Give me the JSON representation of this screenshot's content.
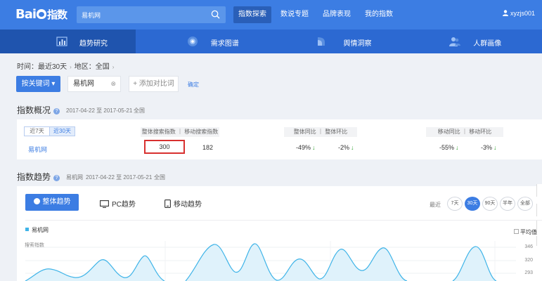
{
  "header": {
    "logo_text": "Bai",
    "logo_suffix": "指数",
    "search": {
      "value": "易机网"
    },
    "nav": [
      {
        "label": "指数探索",
        "active": true
      },
      {
        "label": "数说专题",
        "active": false
      },
      {
        "label": "品牌表现",
        "active": false
      },
      {
        "label": "我的指数",
        "active": false
      }
    ],
    "user": "xyzjs001"
  },
  "subnav": [
    {
      "label": "趋势研究",
      "icon": "bar-chart-icon",
      "active": true
    },
    {
      "label": "需求图谱",
      "icon": "target-icon",
      "active": false
    },
    {
      "label": "舆情洞察",
      "icon": "insight-icon",
      "active": false
    },
    {
      "label": "人群画像",
      "icon": "people-icon",
      "active": false
    }
  ],
  "filters": {
    "time": "时间：最近30天",
    "region": "地区：全国",
    "keyword_button": "按关键词",
    "keyword": "易机网",
    "add_compare": "+ 添加对比词",
    "confirm": "确定"
  },
  "overview": {
    "title": "指数概况",
    "date_range": "2017-04-22 至 2017-05-21",
    "region": "全国",
    "tabs": [
      "近7天",
      "近30天"
    ],
    "active_tab": 1,
    "headers": {
      "search": "整体搜索指数 ｜ 移动搜索指数",
      "yoy": "整体同比 ｜ 整体环比",
      "mobile": "移动同比 ｜ 移动环比"
    },
    "row": {
      "keyword": "易机网",
      "total_search": "300",
      "mobile_search": "182",
      "yoy": "-49%",
      "mom": "-2%",
      "mobile_yoy": "-55%",
      "mobile_mom": "-3%"
    }
  },
  "trend": {
    "title": "指数趋势",
    "keyword": "易机网",
    "date_range": "2017-04-22 至 2017-05-21",
    "region": "全国",
    "modes": [
      "整体趋势",
      "PC趋势",
      "移动趋势"
    ],
    "recent_label": "最近",
    "ranges": [
      "7天",
      "30天",
      "90天",
      "半年",
      "全部"
    ],
    "active_range": 1,
    "legend": "易机网",
    "avg_label": "平均值",
    "ylabel": "搜索指数",
    "yticks": [
      "346",
      "320",
      "293"
    ]
  },
  "colors": {
    "brand": "#3c7de3",
    "subnav": "#2c69d2",
    "line": "#3fb4e8",
    "highlight": "#d8302f",
    "down": "#37a437"
  }
}
